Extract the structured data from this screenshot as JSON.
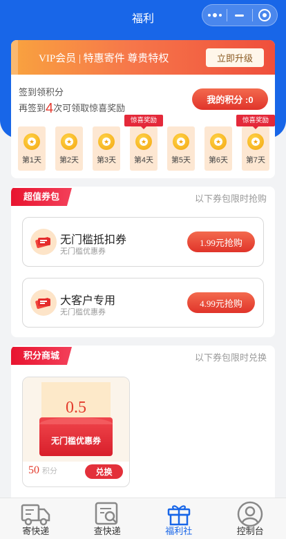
{
  "header": {
    "title": "福利"
  },
  "vip": {
    "text": "VIP会员 | 特惠寄件 尊贵特权",
    "button": "立即升级"
  },
  "signin": {
    "line1": "签到领积分",
    "line2_prefix": "再签到",
    "line2_count": "4",
    "line2_suffix": "次可领取惊喜奖励",
    "points_button": "我的积分 :0",
    "days": [
      "第1天",
      "第2天",
      "第3天",
      "第4天",
      "第5天",
      "第6天",
      "第7天"
    ],
    "bonus_label": "惊喜奖励"
  },
  "coupons": {
    "title": "超值券包",
    "subtitle": "以下券包限时抢购",
    "items": [
      {
        "name": "无门槛抵扣券",
        "desc": "无门槛优惠券",
        "button": "1.99元抢购"
      },
      {
        "name": "大客户专用",
        "desc": "无门槛优惠券",
        "button": "4.99元抢购"
      }
    ]
  },
  "mall": {
    "title": "积分商城",
    "subtitle": "以下券包限时兑换",
    "product": {
      "value": "0.5",
      "name": "无门槛优惠券",
      "points": "50",
      "points_unit": "积分",
      "button": "兑换"
    }
  },
  "tabbar": {
    "items": [
      {
        "label": "寄快递",
        "icon": "truck-icon"
      },
      {
        "label": "查快递",
        "icon": "search-doc-icon"
      },
      {
        "label": "福利社",
        "icon": "gift-icon",
        "active": true
      },
      {
        "label": "控制台",
        "icon": "user-icon"
      }
    ]
  },
  "colors": {
    "primary": "#1866e8",
    "accent": "#e53a2f",
    "tag": "#e8142f"
  }
}
